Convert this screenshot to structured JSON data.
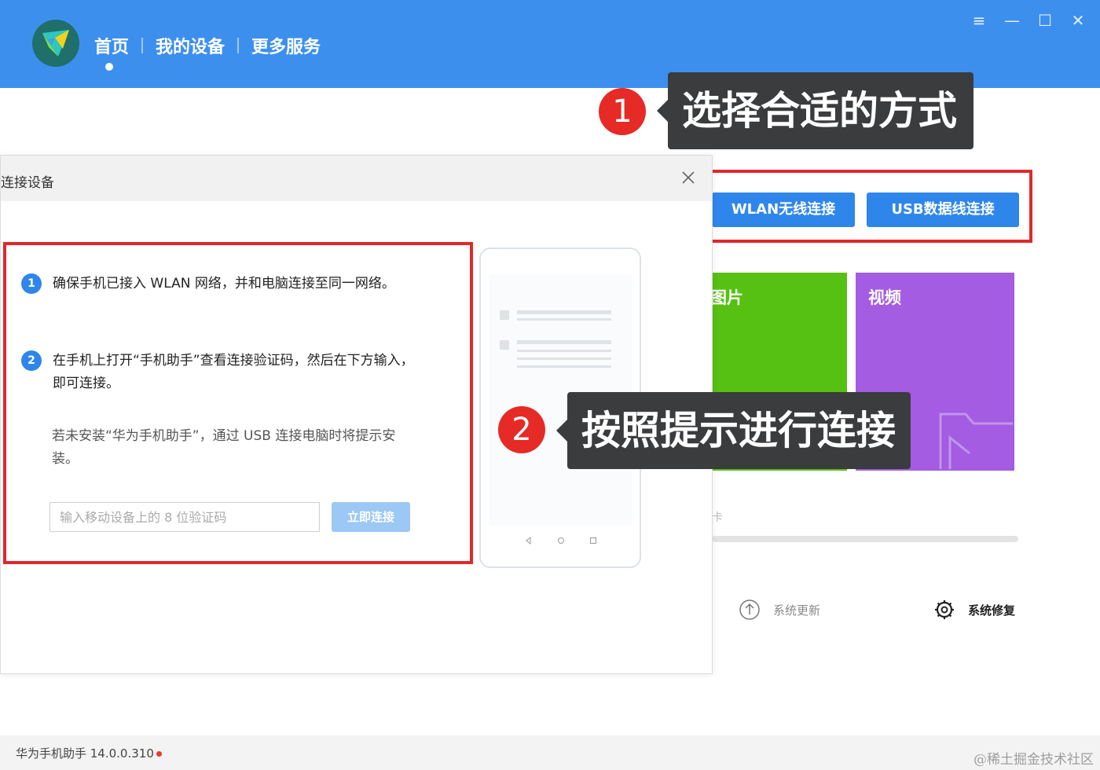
{
  "header": {
    "nav": [
      {
        "label": "首页"
      },
      {
        "label": "我的设备"
      },
      {
        "label": "更多服务"
      }
    ]
  },
  "window_controls": {
    "menu_glyph": "≡",
    "min_glyph": "—",
    "max_glyph": "☐",
    "close_glyph": "✕"
  },
  "connect_methods": {
    "wlan_label": "WLAN无线连接",
    "usb_label": "USB数据线连接"
  },
  "tiles": [
    {
      "label": "图片",
      "color": "#56c112"
    },
    {
      "label": "视频",
      "color": "#a35ce2"
    }
  ],
  "bottom_links": {
    "update_label": "系统更新",
    "repair_label": "系统修复",
    "faint_char": "卡"
  },
  "dialog": {
    "title": "连接设备",
    "steps": [
      {
        "num": "1",
        "text": "确保手机已接入 WLAN 网络，并和电脑连接至同一网络。"
      },
      {
        "num": "2",
        "text": "在手机上打开“手机助手”查看连接验证码，然后在下方输入，即可连接。"
      }
    ],
    "note": "若未安装“华为手机助手”，通过 USB 连接电脑时将提示安装。",
    "input_placeholder": "输入移动设备上的 8 位验证码",
    "connect_label": "立即连接"
  },
  "callouts": [
    {
      "num": "1",
      "text": "选择合适的方式"
    },
    {
      "num": "2",
      "text": "按照提示进行连接"
    }
  ],
  "status": {
    "app_version": "华为手机助手 14.0.0.310",
    "watermark": "@稀土掘金技术社区"
  },
  "colors": {
    "header_blue": "#3d8fee",
    "button_blue": "#2f86ea",
    "highlight_red": "#e0282d",
    "callout_bg": "#3b3c3e"
  }
}
